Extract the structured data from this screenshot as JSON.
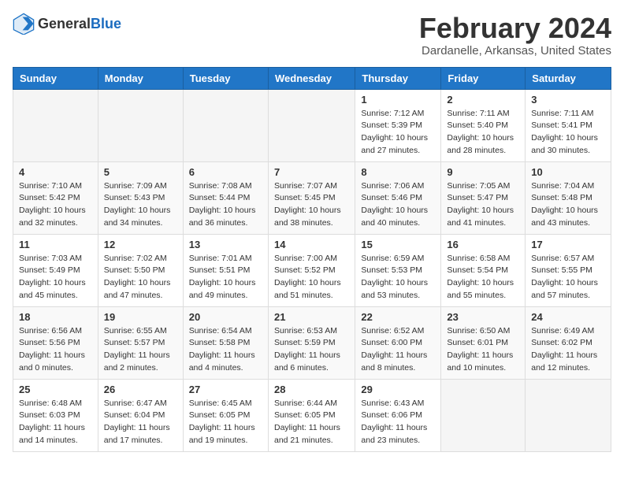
{
  "header": {
    "logo_general": "General",
    "logo_blue": "Blue",
    "month": "February 2024",
    "location": "Dardanelle, Arkansas, United States"
  },
  "weekdays": [
    "Sunday",
    "Monday",
    "Tuesday",
    "Wednesday",
    "Thursday",
    "Friday",
    "Saturday"
  ],
  "weeks": [
    [
      {
        "day": "",
        "info": ""
      },
      {
        "day": "",
        "info": ""
      },
      {
        "day": "",
        "info": ""
      },
      {
        "day": "",
        "info": ""
      },
      {
        "day": "1",
        "info": "Sunrise: 7:12 AM\nSunset: 5:39 PM\nDaylight: 10 hours\nand 27 minutes."
      },
      {
        "day": "2",
        "info": "Sunrise: 7:11 AM\nSunset: 5:40 PM\nDaylight: 10 hours\nand 28 minutes."
      },
      {
        "day": "3",
        "info": "Sunrise: 7:11 AM\nSunset: 5:41 PM\nDaylight: 10 hours\nand 30 minutes."
      }
    ],
    [
      {
        "day": "4",
        "info": "Sunrise: 7:10 AM\nSunset: 5:42 PM\nDaylight: 10 hours\nand 32 minutes."
      },
      {
        "day": "5",
        "info": "Sunrise: 7:09 AM\nSunset: 5:43 PM\nDaylight: 10 hours\nand 34 minutes."
      },
      {
        "day": "6",
        "info": "Sunrise: 7:08 AM\nSunset: 5:44 PM\nDaylight: 10 hours\nand 36 minutes."
      },
      {
        "day": "7",
        "info": "Sunrise: 7:07 AM\nSunset: 5:45 PM\nDaylight: 10 hours\nand 38 minutes."
      },
      {
        "day": "8",
        "info": "Sunrise: 7:06 AM\nSunset: 5:46 PM\nDaylight: 10 hours\nand 40 minutes."
      },
      {
        "day": "9",
        "info": "Sunrise: 7:05 AM\nSunset: 5:47 PM\nDaylight: 10 hours\nand 41 minutes."
      },
      {
        "day": "10",
        "info": "Sunrise: 7:04 AM\nSunset: 5:48 PM\nDaylight: 10 hours\nand 43 minutes."
      }
    ],
    [
      {
        "day": "11",
        "info": "Sunrise: 7:03 AM\nSunset: 5:49 PM\nDaylight: 10 hours\nand 45 minutes."
      },
      {
        "day": "12",
        "info": "Sunrise: 7:02 AM\nSunset: 5:50 PM\nDaylight: 10 hours\nand 47 minutes."
      },
      {
        "day": "13",
        "info": "Sunrise: 7:01 AM\nSunset: 5:51 PM\nDaylight: 10 hours\nand 49 minutes."
      },
      {
        "day": "14",
        "info": "Sunrise: 7:00 AM\nSunset: 5:52 PM\nDaylight: 10 hours\nand 51 minutes."
      },
      {
        "day": "15",
        "info": "Sunrise: 6:59 AM\nSunset: 5:53 PM\nDaylight: 10 hours\nand 53 minutes."
      },
      {
        "day": "16",
        "info": "Sunrise: 6:58 AM\nSunset: 5:54 PM\nDaylight: 10 hours\nand 55 minutes."
      },
      {
        "day": "17",
        "info": "Sunrise: 6:57 AM\nSunset: 5:55 PM\nDaylight: 10 hours\nand 57 minutes."
      }
    ],
    [
      {
        "day": "18",
        "info": "Sunrise: 6:56 AM\nSunset: 5:56 PM\nDaylight: 11 hours\nand 0 minutes."
      },
      {
        "day": "19",
        "info": "Sunrise: 6:55 AM\nSunset: 5:57 PM\nDaylight: 11 hours\nand 2 minutes."
      },
      {
        "day": "20",
        "info": "Sunrise: 6:54 AM\nSunset: 5:58 PM\nDaylight: 11 hours\nand 4 minutes."
      },
      {
        "day": "21",
        "info": "Sunrise: 6:53 AM\nSunset: 5:59 PM\nDaylight: 11 hours\nand 6 minutes."
      },
      {
        "day": "22",
        "info": "Sunrise: 6:52 AM\nSunset: 6:00 PM\nDaylight: 11 hours\nand 8 minutes."
      },
      {
        "day": "23",
        "info": "Sunrise: 6:50 AM\nSunset: 6:01 PM\nDaylight: 11 hours\nand 10 minutes."
      },
      {
        "day": "24",
        "info": "Sunrise: 6:49 AM\nSunset: 6:02 PM\nDaylight: 11 hours\nand 12 minutes."
      }
    ],
    [
      {
        "day": "25",
        "info": "Sunrise: 6:48 AM\nSunset: 6:03 PM\nDaylight: 11 hours\nand 14 minutes."
      },
      {
        "day": "26",
        "info": "Sunrise: 6:47 AM\nSunset: 6:04 PM\nDaylight: 11 hours\nand 17 minutes."
      },
      {
        "day": "27",
        "info": "Sunrise: 6:45 AM\nSunset: 6:05 PM\nDaylight: 11 hours\nand 19 minutes."
      },
      {
        "day": "28",
        "info": "Sunrise: 6:44 AM\nSunset: 6:05 PM\nDaylight: 11 hours\nand 21 minutes."
      },
      {
        "day": "29",
        "info": "Sunrise: 6:43 AM\nSunset: 6:06 PM\nDaylight: 11 hours\nand 23 minutes."
      },
      {
        "day": "",
        "info": ""
      },
      {
        "day": "",
        "info": ""
      }
    ]
  ]
}
